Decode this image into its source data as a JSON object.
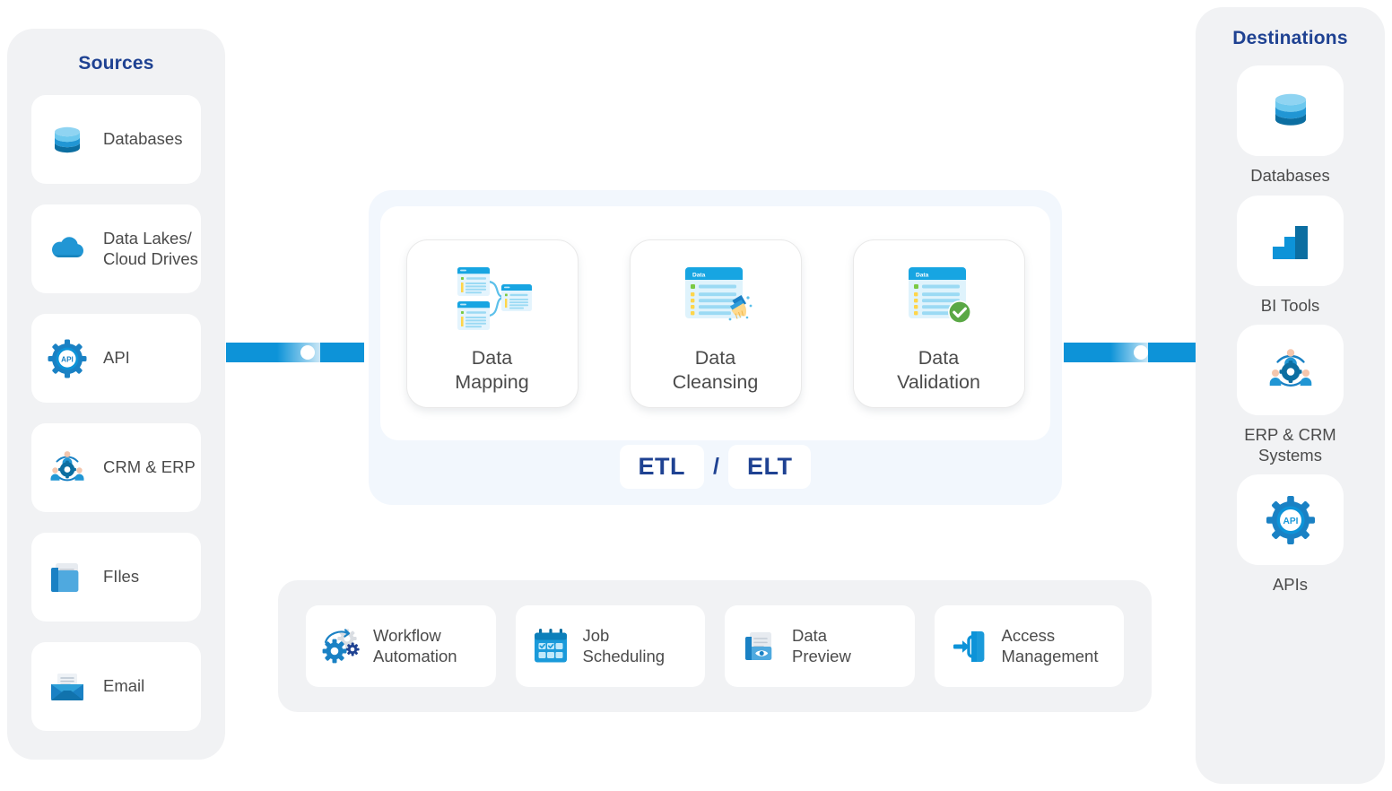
{
  "sources": {
    "title": "Sources",
    "items": [
      {
        "label": "Databases",
        "icon": "database-icon"
      },
      {
        "label": "Data Lakes/\nCloud Drives",
        "icon": "cloud-icon"
      },
      {
        "label": "API",
        "icon": "api-gear-icon"
      },
      {
        "label": "CRM & ERP",
        "icon": "people-network-icon"
      },
      {
        "label": "FIles",
        "icon": "files-icon"
      },
      {
        "label": "Email",
        "icon": "email-icon"
      }
    ]
  },
  "pipeline": {
    "stages": [
      {
        "label": "Data\nMapping",
        "icon": "data-mapping-icon"
      },
      {
        "label": "Data\nCleansing",
        "icon": "data-cleansing-icon"
      },
      {
        "label": "Data\nValidation",
        "icon": "data-validation-icon"
      }
    ],
    "mode_left": "ETL",
    "mode_separator": "/",
    "mode_right": "ELT",
    "window_title": "Data"
  },
  "features": {
    "items": [
      {
        "label": "Workflow\nAutomation",
        "icon": "gears-icon"
      },
      {
        "label": "Job\nScheduling",
        "icon": "calendar-icon"
      },
      {
        "label": "Data\nPreview",
        "icon": "document-eye-icon"
      },
      {
        "label": "Access\nManagement",
        "icon": "login-door-icon"
      }
    ]
  },
  "destinations": {
    "title": "Destinations",
    "items": [
      {
        "label": "Databases",
        "icon": "database-icon"
      },
      {
        "label": "BI Tools",
        "icon": "bar-chart-icon"
      },
      {
        "label": "ERP & CRM\nSystems",
        "icon": "people-network-icon"
      },
      {
        "label": "APIs",
        "icon": "api-gear-icon"
      }
    ]
  },
  "connectors": {
    "left": "flow-left",
    "right": "flow-right"
  },
  "colors": {
    "brand_navy": "#1f4292",
    "accent_blue": "#0d93d8",
    "light_blue": "#5ec3ee",
    "dark_blue": "#0c6ea1",
    "panel_gray": "#f1f2f4",
    "center_panel": "#f2f7fd",
    "text_gray": "#4b4b4b",
    "success_green": "#5aa845"
  }
}
